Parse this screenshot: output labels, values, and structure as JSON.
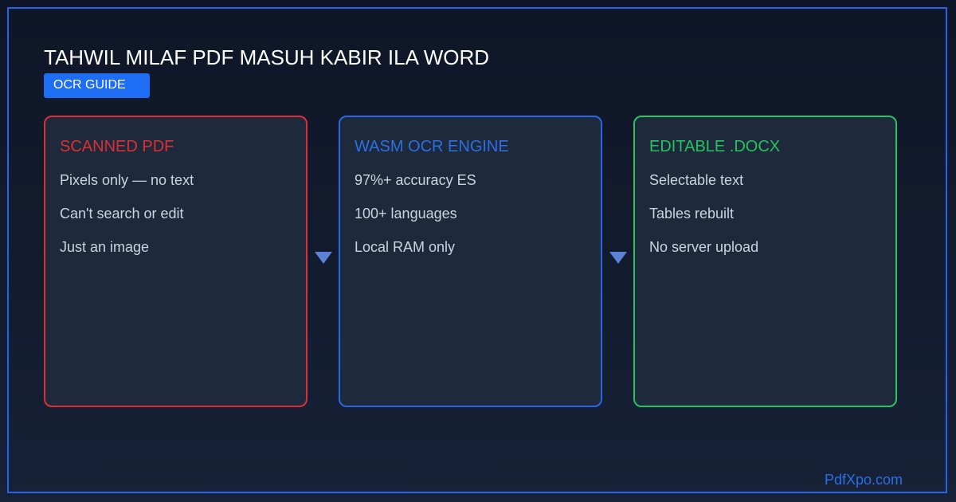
{
  "header": {
    "title": "TAHWIL MILAF PDF MASUH KABIR ILA WORD",
    "badge": "OCR GUIDE"
  },
  "cards": [
    {
      "title": "SCANNED PDF",
      "color": "#dc2f34",
      "items": [
        "Pixels only — no text",
        "Can't search or edit",
        "Just an image"
      ]
    },
    {
      "title": "WASM OCR ENGINE",
      "color": "#2a6fe6",
      "items": [
        "97%+ accuracy ES",
        "100+ languages",
        "Local RAM only"
      ]
    },
    {
      "title": "EDITABLE .DOCX",
      "color": "#22c55e",
      "items": [
        "Selectable text",
        "Tables rebuilt",
        "No server upload"
      ]
    }
  ],
  "arrows": [
    {
      "icon": "triangle-down-icon"
    },
    {
      "icon": "triangle-down-icon"
    }
  ],
  "footer": {
    "brand": "PdfXpo.com"
  },
  "colors": {
    "background": "#131b2e",
    "frame": "#2563eb",
    "badge": "#1e6ef5",
    "card_background": "#1e293b",
    "text_muted": "#cbd5e1",
    "arrow": "#5b82d6"
  }
}
